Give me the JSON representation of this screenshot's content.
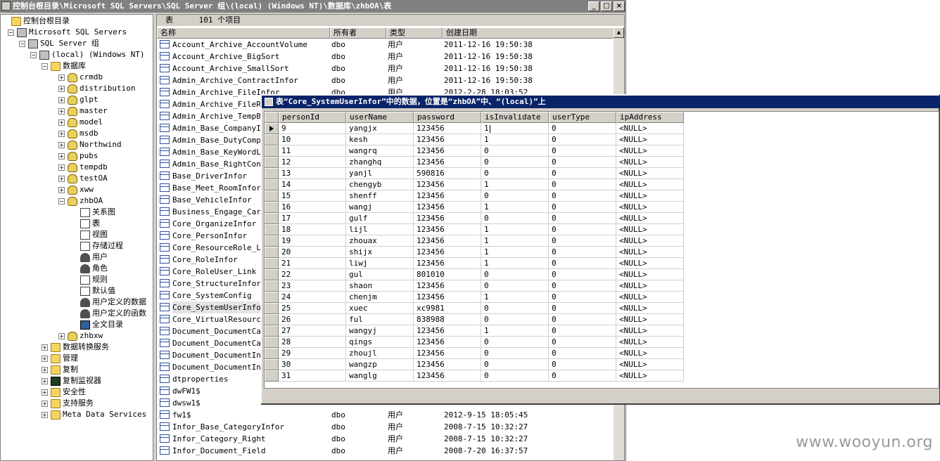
{
  "main_window": {
    "title": "控制台根目录\\Microsoft SQL Servers\\SQL Server 组\\(local) (Windows NT)\\数据库\\zhbOA\\表",
    "min_label": "_",
    "max_label": "□",
    "close_label": "×"
  },
  "tree": {
    "items": [
      {
        "label": "控制台根目录",
        "icon": "folder-icon",
        "exp": ""
      },
      {
        "label": "Microsoft SQL Servers",
        "icon": "server-group-icon",
        "exp": "−"
      },
      {
        "label": "SQL Server 组",
        "icon": "server-group-icon",
        "exp": "−"
      },
      {
        "label": "(local) (Windows NT)",
        "icon": "server-icon",
        "exp": "−"
      },
      {
        "label": "数据库",
        "icon": "folder-icon",
        "exp": "−"
      },
      {
        "label": "crmdb",
        "icon": "database-icon",
        "exp": "+"
      },
      {
        "label": "distribution",
        "icon": "database-icon",
        "exp": "+"
      },
      {
        "label": "glpt",
        "icon": "database-icon",
        "exp": "+"
      },
      {
        "label": "master",
        "icon": "database-icon",
        "exp": "+"
      },
      {
        "label": "model",
        "icon": "database-icon",
        "exp": "+"
      },
      {
        "label": "msdb",
        "icon": "database-icon",
        "exp": "+"
      },
      {
        "label": "Northwind",
        "icon": "database-icon",
        "exp": "+"
      },
      {
        "label": "pubs",
        "icon": "database-icon",
        "exp": "+"
      },
      {
        "label": "tempdb",
        "icon": "database-icon",
        "exp": "+"
      },
      {
        "label": "testOA",
        "icon": "database-icon",
        "exp": "+"
      },
      {
        "label": "xww",
        "icon": "database-icon",
        "exp": "+"
      },
      {
        "label": "zhbOA",
        "icon": "database-icon",
        "exp": "−"
      },
      {
        "label": "关系图",
        "icon": "diagram-icon",
        "exp": ""
      },
      {
        "label": "表",
        "icon": "table-icon",
        "exp": ""
      },
      {
        "label": "视图",
        "icon": "view-icon",
        "exp": ""
      },
      {
        "label": "存储过程",
        "icon": "stored-procedure-icon",
        "exp": ""
      },
      {
        "label": "用户",
        "icon": "user-icon",
        "exp": ""
      },
      {
        "label": "角色",
        "icon": "role-icon",
        "exp": ""
      },
      {
        "label": "规则",
        "icon": "rule-icon",
        "exp": ""
      },
      {
        "label": "默认值",
        "icon": "default-icon",
        "exp": ""
      },
      {
        "label": "用户定义的数据",
        "icon": "user-defined-type-icon",
        "exp": ""
      },
      {
        "label": "用户定义的函数",
        "icon": "user-defined-function-icon",
        "exp": ""
      },
      {
        "label": "全文目录",
        "icon": "fulltext-catalog-icon",
        "exp": ""
      },
      {
        "label": "zhbxw",
        "icon": "database-icon",
        "exp": "+"
      },
      {
        "label": "数据转换服务",
        "icon": "folder-icon",
        "exp": "+"
      },
      {
        "label": "管理",
        "icon": "folder-icon",
        "exp": "+"
      },
      {
        "label": "复制",
        "icon": "folder-icon",
        "exp": "+"
      },
      {
        "label": "复制监视器",
        "icon": "monitor-icon",
        "exp": "+"
      },
      {
        "label": "安全性",
        "icon": "folder-icon",
        "exp": "+"
      },
      {
        "label": "支持服务",
        "icon": "folder-icon",
        "exp": "+"
      },
      {
        "label": "Meta Data Services",
        "icon": "folder-icon",
        "exp": "+"
      }
    ]
  },
  "list": {
    "header_label": "表",
    "count_label": "101 个项目",
    "columns": [
      "名称",
      "所有者",
      "类型",
      "创建日期"
    ],
    "rows": [
      [
        "Account_Archive_AccountVolume",
        "dbo",
        "用户",
        "2011-12-16 19:50:38"
      ],
      [
        "Account_Archive_BigSort",
        "dbo",
        "用户",
        "2011-12-16 19:50:38"
      ],
      [
        "Account_Archive_SmallSort",
        "dbo",
        "用户",
        "2011-12-16 19:50:38"
      ],
      [
        "Admin_Archive_ContractInfor",
        "dbo",
        "用户",
        "2011-12-16 19:50:38"
      ],
      [
        "Admin_Archive_FileInfor",
        "dbo",
        "用户",
        "2012-2-28 18:03:52"
      ],
      [
        "Admin_Archive_FileRig",
        "",
        "",
        ""
      ],
      [
        "Admin_Archive_TempBro",
        "",
        "",
        ""
      ],
      [
        "Admin_Base_CompanyInf",
        "",
        "",
        ""
      ],
      [
        "Admin_Base_DutyCompar",
        "",
        "",
        ""
      ],
      [
        "Admin_Base_KeyWordLib",
        "",
        "",
        ""
      ],
      [
        "Admin_Base_RightConfi",
        "",
        "",
        ""
      ],
      [
        "Base_DriverInfor",
        "",
        "",
        ""
      ],
      [
        "Base_Meet_RoomInfor",
        "",
        "",
        ""
      ],
      [
        "Base_VehicleInfor",
        "",
        "",
        ""
      ],
      [
        "Business_Engage_Car",
        "",
        "",
        ""
      ],
      [
        "Core_OrganizeInfor",
        "",
        "",
        ""
      ],
      [
        "Core_PersonInfor",
        "",
        "",
        ""
      ],
      [
        "Core_ResourceRole_Lin",
        "",
        "",
        ""
      ],
      [
        "Core_RoleInfor",
        "",
        "",
        ""
      ],
      [
        "Core_RoleUser_Link",
        "",
        "",
        ""
      ],
      [
        "Core_StructureInfor",
        "",
        "",
        ""
      ],
      [
        "Core_SystemConfig",
        "",
        "",
        ""
      ],
      [
        "Core_SystemUserInfor",
        "",
        "",
        ""
      ],
      [
        "Core_VirtualResource",
        "",
        "",
        ""
      ],
      [
        "Document_DocumentCate",
        "",
        "",
        ""
      ],
      [
        "Document_DocumentCate",
        "",
        "",
        ""
      ],
      [
        "Document_DocumentInfo",
        "",
        "",
        ""
      ],
      [
        "Document_DocumentInfo",
        "",
        "",
        ""
      ],
      [
        "dtproperties",
        "",
        "",
        ""
      ],
      [
        "dwFW1$",
        "",
        "",
        ""
      ],
      [
        "dwsw1$",
        "",
        "",
        ""
      ],
      [
        "fw1$",
        "dbo",
        "用户",
        "2012-9-15 18:05:45"
      ],
      [
        "Infor_Base_CategoryInfor",
        "dbo",
        "用户",
        "2008-7-15 10:32:27"
      ],
      [
        "Infor_Category_Right",
        "dbo",
        "用户",
        "2008-7-15 10:32:27"
      ],
      [
        "Infor_Document_Field",
        "dbo",
        "用户",
        "2008-7-20 16:37:57"
      ]
    ]
  },
  "data_window": {
    "title": "表“Core_SystemUserInfor”中的数据，位置是“zhbOA”中、“(local)”上",
    "columns": [
      "personId",
      "userName",
      "password",
      "isInvalidate",
      "userType",
      "ipAddress"
    ],
    "rows": [
      [
        "9",
        "yangjx",
        "123456",
        "1",
        "0",
        "<NULL>"
      ],
      [
        "10",
        "kesh",
        "123456",
        "1",
        "0",
        "<NULL>"
      ],
      [
        "11",
        "wangrq",
        "123456",
        "0",
        "0",
        "<NULL>"
      ],
      [
        "12",
        "zhanghq",
        "123456",
        "0",
        "0",
        "<NULL>"
      ],
      [
        "13",
        "yanjl",
        "590816",
        "0",
        "0",
        "<NULL>"
      ],
      [
        "14",
        "chengyb",
        "123456",
        "1",
        "0",
        "<NULL>"
      ],
      [
        "15",
        "shenff",
        "123456",
        "0",
        "0",
        "<NULL>"
      ],
      [
        "16",
        "wangj",
        "123456",
        "1",
        "0",
        "<NULL>"
      ],
      [
        "17",
        "gulf",
        "123456",
        "0",
        "0",
        "<NULL>"
      ],
      [
        "18",
        "lijl",
        "123456",
        "1",
        "0",
        "<NULL>"
      ],
      [
        "19",
        "zhouax",
        "123456",
        "1",
        "0",
        "<NULL>"
      ],
      [
        "20",
        "shijx",
        "123456",
        "1",
        "0",
        "<NULL>"
      ],
      [
        "21",
        "liwj",
        "123456",
        "1",
        "0",
        "<NULL>"
      ],
      [
        "22",
        "gul",
        "801010",
        "0",
        "0",
        "<NULL>"
      ],
      [
        "23",
        "shaon",
        "123456",
        "0",
        "0",
        "<NULL>"
      ],
      [
        "24",
        "chenjm",
        "123456",
        "1",
        "0",
        "<NULL>"
      ],
      [
        "25",
        "xuec",
        "xc9981",
        "0",
        "0",
        "<NULL>"
      ],
      [
        "26",
        "ful",
        "838988",
        "0",
        "0",
        "<NULL>"
      ],
      [
        "27",
        "wangyj",
        "123456",
        "1",
        "0",
        "<NULL>"
      ],
      [
        "28",
        "qings",
        "123456",
        "0",
        "0",
        "<NULL>"
      ],
      [
        "29",
        "zhoujl",
        "123456",
        "0",
        "0",
        "<NULL>"
      ],
      [
        "30",
        "wangzp",
        "123456",
        "0",
        "0",
        "<NULL>"
      ],
      [
        "31",
        "wanglg",
        "123456",
        "0",
        "0",
        "<NULL>"
      ]
    ]
  },
  "watermark": "www.wooyun.org"
}
